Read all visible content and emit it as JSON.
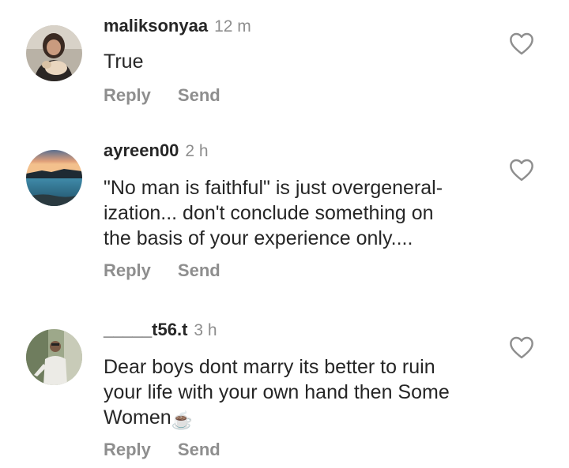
{
  "comments": [
    {
      "username": "maliksonyaa",
      "time": "12 m",
      "text": "True",
      "reply": "Reply",
      "send": "Send"
    },
    {
      "username": "ayreen00",
      "time": "2 h",
      "text": "\"No man is faithful\" is just overgeneral-\nization... don't conclude something on\nthe basis of your experience only....",
      "reply": "Reply",
      "send": "Send"
    },
    {
      "username": "_____t56.t",
      "time": "3 h",
      "text": "Dear boys dont marry its better to ruin\nyour life with your own hand then Some\nWomen",
      "emoji": "☕",
      "reply": "Reply",
      "send": "Send"
    }
  ],
  "icons": {
    "like": "heart-outline-icon",
    "emoji": "hot-beverage-icon"
  },
  "colors": {
    "text": "#262626",
    "secondary": "#8e8e8e",
    "background": "#ffffff"
  }
}
